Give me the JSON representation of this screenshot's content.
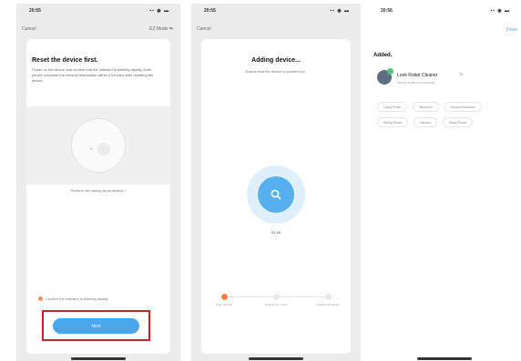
{
  "reset_screen": {
    "status_time": "20:55",
    "status_icons": "▪▪ ◉ ▬",
    "nav_left": "Cancel",
    "nav_right": "EZ Mode ⇆",
    "title": "Reset the device first.",
    "description": "Power on the device and confirm that the indicator is blinking rapidly. Note: please complete the network distribution within 3 minutes after resetting the device.",
    "help_link": "Perform net pairing as prompted >",
    "confirm_text": "Confirm the indicator is blinking rapidly",
    "next_label": "Next"
  },
  "adding_screen": {
    "status_time": "20:55",
    "status_icons": "▪▪ ◉ ▬",
    "nav_left": "Cancel",
    "title": "Adding device...",
    "subtitle": "Ensure that the device is powered on.",
    "countdown": "01:49",
    "steps": [
      {
        "label": "Scan devices"
      },
      {
        "label": "Register on Cloud"
      },
      {
        "label": "Initialize the device"
      }
    ]
  },
  "added_screen": {
    "status_time": "20:56",
    "status_icons": "▪▪ ◉ ▬",
    "done_label": "Done",
    "added_title": "Added.",
    "device_name": "Look Robot Cleaner",
    "device_status": "Device added successfully",
    "rooms": [
      "Living Room",
      "Bedroom",
      "Second Bedroom",
      "Dining Room",
      "Kitchen",
      "Study Room"
    ]
  },
  "colors": {
    "accent_blue": "#4ba7ec",
    "step_orange": "#f5804a",
    "highlight_red": "#cf1f24",
    "success_green": "#4cc57e"
  },
  "icons": {
    "search": "search-icon",
    "edit": "edit-pencil-icon",
    "check": "check-icon"
  }
}
